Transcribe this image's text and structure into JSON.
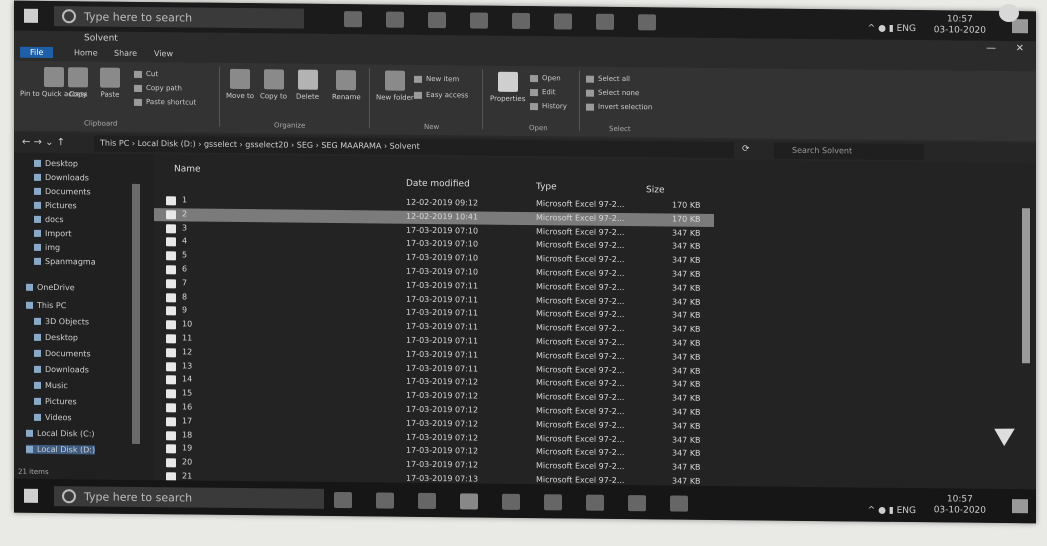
{
  "top_taskbar": {
    "search_placeholder": "Type here to search",
    "tray_text": "^ ● ▮ ENG",
    "clock_time": "10:57",
    "clock_date": "03-10-2020"
  },
  "window": {
    "title": "Solvent"
  },
  "ribbon_tabs": [
    "File",
    "Home",
    "Share",
    "View"
  ],
  "ribbon": {
    "pin_label": "Pin to Quick access",
    "copy_label": "Copy",
    "paste_label": "Paste",
    "cut_label": "Cut",
    "copy_path_label": "Copy path",
    "paste_shortcut_label": "Paste shortcut",
    "move_to_label": "Move to",
    "copy_to_label": "Copy to",
    "delete_label": "Delete",
    "rename_label": "Rename",
    "new_folder_label": "New folder",
    "new_item_label": "New item",
    "easy_access_label": "Easy access",
    "properties_label": "Properties",
    "open_label": "Open",
    "edit_label": "Edit",
    "history_label": "History",
    "select_all_label": "Select all",
    "select_none_label": "Select none",
    "invert_selection_label": "Invert selection",
    "groups": [
      "Clipboard",
      "Organize",
      "New",
      "Open",
      "Select"
    ]
  },
  "address": {
    "path": "This PC  ›  Local Disk (D:)  ›  gsselect  ›  gsselect20  ›  SEG  ›  SEG MAARAMA  ›  Solvent",
    "search_placeholder": "Search Solvent"
  },
  "nav_pane": [
    "Desktop",
    "Downloads",
    "Documents",
    "Pictures",
    "docs",
    "Import",
    "img",
    "Spanmagma",
    "OneDrive",
    "This PC",
    "3D Objects",
    "Desktop",
    "Documents",
    "Downloads",
    "Music",
    "Pictures",
    "Videos",
    "Local Disk (C:)",
    "Local Disk (D:)"
  ],
  "columns": {
    "name": "Name",
    "date": "Date modified",
    "type": "Type",
    "size": "Size"
  },
  "files": [
    {
      "name": "1",
      "date": "12-02-2019 09:12",
      "type": "Microsoft Excel 97-2...",
      "size": "170 KB"
    },
    {
      "name": "2",
      "date": "12-02-2019 10:41",
      "type": "Microsoft Excel 97-2...",
      "size": "170 KB"
    },
    {
      "name": "3",
      "date": "17-03-2019 07:10",
      "type": "Microsoft Excel 97-2...",
      "size": "347 KB"
    },
    {
      "name": "4",
      "date": "17-03-2019 07:10",
      "type": "Microsoft Excel 97-2...",
      "size": "347 KB"
    },
    {
      "name": "5",
      "date": "17-03-2019 07:10",
      "type": "Microsoft Excel 97-2...",
      "size": "347 KB"
    },
    {
      "name": "6",
      "date": "17-03-2019 07:10",
      "type": "Microsoft Excel 97-2...",
      "size": "347 KB"
    },
    {
      "name": "7",
      "date": "17-03-2019 07:11",
      "type": "Microsoft Excel 97-2...",
      "size": "347 KB"
    },
    {
      "name": "8",
      "date": "17-03-2019 07:11",
      "type": "Microsoft Excel 97-2...",
      "size": "347 KB"
    },
    {
      "name": "9",
      "date": "17-03-2019 07:11",
      "type": "Microsoft Excel 97-2...",
      "size": "347 KB"
    },
    {
      "name": "10",
      "date": "17-03-2019 07:11",
      "type": "Microsoft Excel 97-2...",
      "size": "347 KB"
    },
    {
      "name": "11",
      "date": "17-03-2019 07:11",
      "type": "Microsoft Excel 97-2...",
      "size": "347 KB"
    },
    {
      "name": "12",
      "date": "17-03-2019 07:11",
      "type": "Microsoft Excel 97-2...",
      "size": "347 KB"
    },
    {
      "name": "13",
      "date": "17-03-2019 07:11",
      "type": "Microsoft Excel 97-2...",
      "size": "347 KB"
    },
    {
      "name": "14",
      "date": "17-03-2019 07:12",
      "type": "Microsoft Excel 97-2...",
      "size": "347 KB"
    },
    {
      "name": "15",
      "date": "17-03-2019 07:12",
      "type": "Microsoft Excel 97-2...",
      "size": "347 KB"
    },
    {
      "name": "16",
      "date": "17-03-2019 07:12",
      "type": "Microsoft Excel 97-2...",
      "size": "347 KB"
    },
    {
      "name": "17",
      "date": "17-03-2019 07:12",
      "type": "Microsoft Excel 97-2...",
      "size": "347 KB"
    },
    {
      "name": "18",
      "date": "17-03-2019 07:12",
      "type": "Microsoft Excel 97-2...",
      "size": "347 KB"
    },
    {
      "name": "19",
      "date": "17-03-2019 07:12",
      "type": "Microsoft Excel 97-2...",
      "size": "347 KB"
    },
    {
      "name": "20",
      "date": "17-03-2019 07:12",
      "type": "Microsoft Excel 97-2...",
      "size": "347 KB"
    },
    {
      "name": "21",
      "date": "17-03-2019 07:13",
      "type": "Microsoft Excel 97-2...",
      "size": "347 KB"
    }
  ],
  "status": {
    "items": "21 items"
  },
  "bottom_taskbar": {
    "search_placeholder": "Type here to search",
    "tray_text": "^ ● ▮ ENG",
    "clock_time": "10:57",
    "clock_date": "03-10-2020"
  },
  "colors": {
    "selection": "#7b7b7b",
    "file_tab": "#1f5fa8"
  }
}
